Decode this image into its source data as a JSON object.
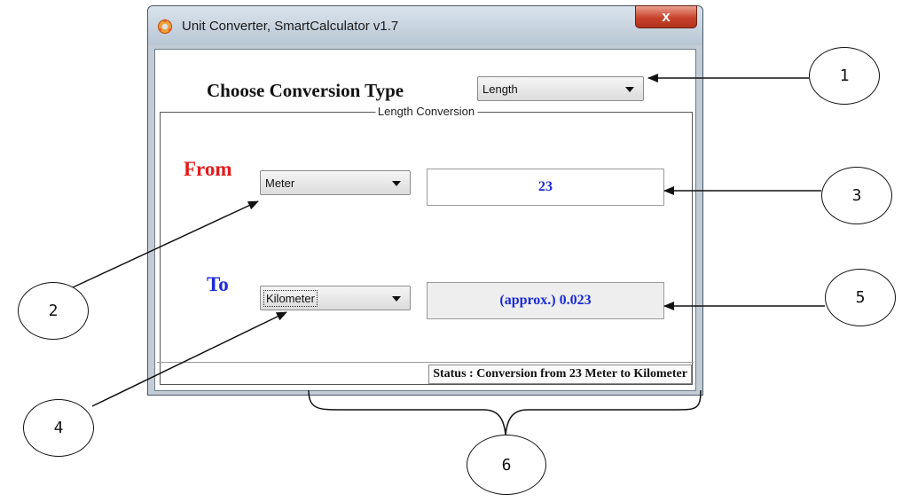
{
  "window": {
    "title": "Unit Converter, SmartCalculator v1.7",
    "close_label": "x",
    "icon": "app-logo-icon"
  },
  "conversion_type": {
    "label": "Choose Conversion Type",
    "selected": "Length"
  },
  "group": {
    "legend": "Length Conversion"
  },
  "from": {
    "label": "From",
    "unit": "Meter",
    "value": "23"
  },
  "to": {
    "label": "To",
    "unit": "Kilometer",
    "value": "(approx.) 0.023"
  },
  "status": {
    "text": "Status :  Conversion from 23 Meter to Kilometer"
  },
  "callouts": [
    "1",
    "2",
    "3",
    "4",
    "5",
    "6"
  ],
  "colors": {
    "from_label": "#e31b1b",
    "to_label": "#1a2bd6",
    "value_text": "#1a2bd6",
    "close_button": "#c8422b"
  }
}
